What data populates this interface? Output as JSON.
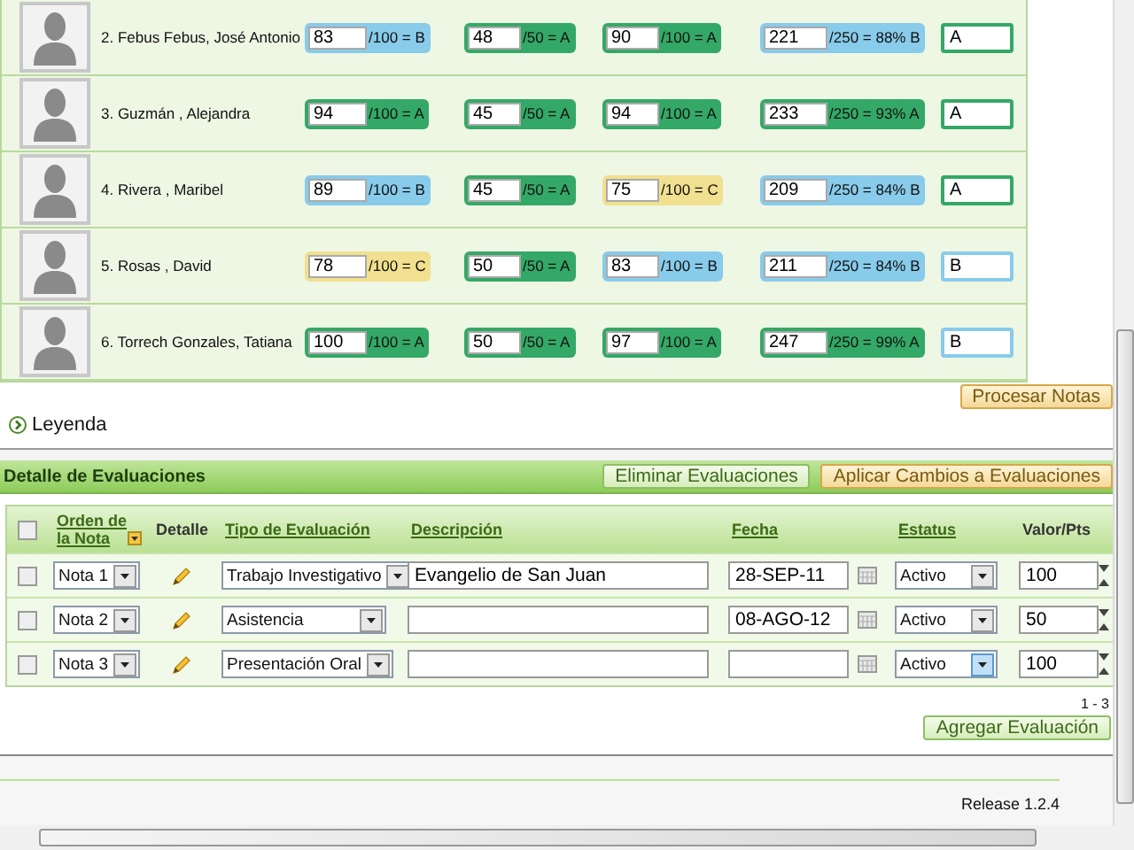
{
  "students": [
    {
      "name": "2. Febus Febus, José Antonio",
      "scores": [
        {
          "value": "83",
          "label": "/100 = B",
          "color": "#88cbea"
        },
        {
          "value": "48",
          "label": "/50 = A",
          "color": "#34a866"
        },
        {
          "value": "90",
          "label": "/100 = A",
          "color": "#34a866"
        },
        {
          "value": "221",
          "label": "/250 = 88% B",
          "color": "#88cbea"
        }
      ],
      "final": {
        "value": "A",
        "color": "#34a866"
      }
    },
    {
      "name": "3. Guzmán , Alejandra",
      "scores": [
        {
          "value": "94",
          "label": "/100 = A",
          "color": "#34a866"
        },
        {
          "value": "45",
          "label": "/50 = A",
          "color": "#34a866"
        },
        {
          "value": "94",
          "label": "/100 = A",
          "color": "#34a866"
        },
        {
          "value": "233",
          "label": "/250 = 93% A",
          "color": "#34a866"
        }
      ],
      "final": {
        "value": "A",
        "color": "#34a866"
      }
    },
    {
      "name": "4. Rivera , Maribel",
      "scores": [
        {
          "value": "89",
          "label": "/100 = B",
          "color": "#88cbea"
        },
        {
          "value": "45",
          "label": "/50 = A",
          "color": "#34a866"
        },
        {
          "value": "75",
          "label": "/100 = C",
          "color": "#f1e08f"
        },
        {
          "value": "209",
          "label": "/250 = 84% B",
          "color": "#88cbea"
        }
      ],
      "final": {
        "value": "A",
        "color": "#34a866"
      }
    },
    {
      "name": "5. Rosas , David",
      "scores": [
        {
          "value": "78",
          "label": "/100 = C",
          "color": "#f1e08f"
        },
        {
          "value": "50",
          "label": "/50 = A",
          "color": "#34a866"
        },
        {
          "value": "83",
          "label": "/100 = B",
          "color": "#88cbea"
        },
        {
          "value": "211",
          "label": "/250 = 84% B",
          "color": "#88cbea"
        }
      ],
      "final": {
        "value": "B",
        "color": "#88cbea"
      }
    },
    {
      "name": "6. Torrech Gonzales, Tatiana",
      "scores": [
        {
          "value": "100",
          "label": "/100 = A",
          "color": "#34a866"
        },
        {
          "value": "50",
          "label": "/50 = A",
          "color": "#34a866"
        },
        {
          "value": "97",
          "label": "/100 = A",
          "color": "#34a866"
        },
        {
          "value": "247",
          "label": "/250 = 99% A",
          "color": "#34a866"
        }
      ],
      "final": {
        "value": "B",
        "color": "#88cbea"
      }
    }
  ],
  "process_button": {
    "label": "Procesar Notas",
    "kind": "primary"
  },
  "legend": {
    "label": "Leyenda",
    "expanded": false
  },
  "evaluations": {
    "title": "Detalle de Evaluaciones",
    "buttons": [
      {
        "label": "Eliminar Evaluaciones",
        "kind": "secondary"
      },
      {
        "label": "Aplicar Cambios a Evaluaciones",
        "kind": "primary"
      }
    ],
    "select_all_checked": false,
    "columns": [
      {
        "label": "Orden de la Nota",
        "kind": "sort"
      },
      {
        "label": "Detalle",
        "kind": "plain"
      },
      {
        "label": "Tipo de Evaluación",
        "kind": "link"
      },
      {
        "label": "Descripción",
        "kind": "link"
      },
      {
        "label": "Fecha",
        "kind": "link"
      },
      {
        "label": "Estatus",
        "kind": "link"
      },
      {
        "label": "Valor/Pts",
        "kind": "plain"
      }
    ],
    "rows": [
      {
        "checked": false,
        "order": "Nota 1",
        "type": "Trabajo Investigativo",
        "description": "Evangelio de San Juan",
        "date": "28-SEP-11",
        "status": "Activo",
        "status_focused": false,
        "points": "100"
      },
      {
        "checked": false,
        "order": "Nota 2",
        "type": "Asistencia",
        "date": "08-AGO-12",
        "status": "Activo",
        "status_focused": false,
        "points": "50"
      },
      {
        "checked": false,
        "order": "Nota 3",
        "type": "Presentación Oral",
        "status": "Activo",
        "status_focused": true,
        "points": "100"
      }
    ],
    "pager": "1 - 3",
    "add_button": {
      "label": "Agregar Evaluación",
      "kind": "secondary"
    }
  },
  "footer": {
    "release": "Release 1.2.4"
  }
}
